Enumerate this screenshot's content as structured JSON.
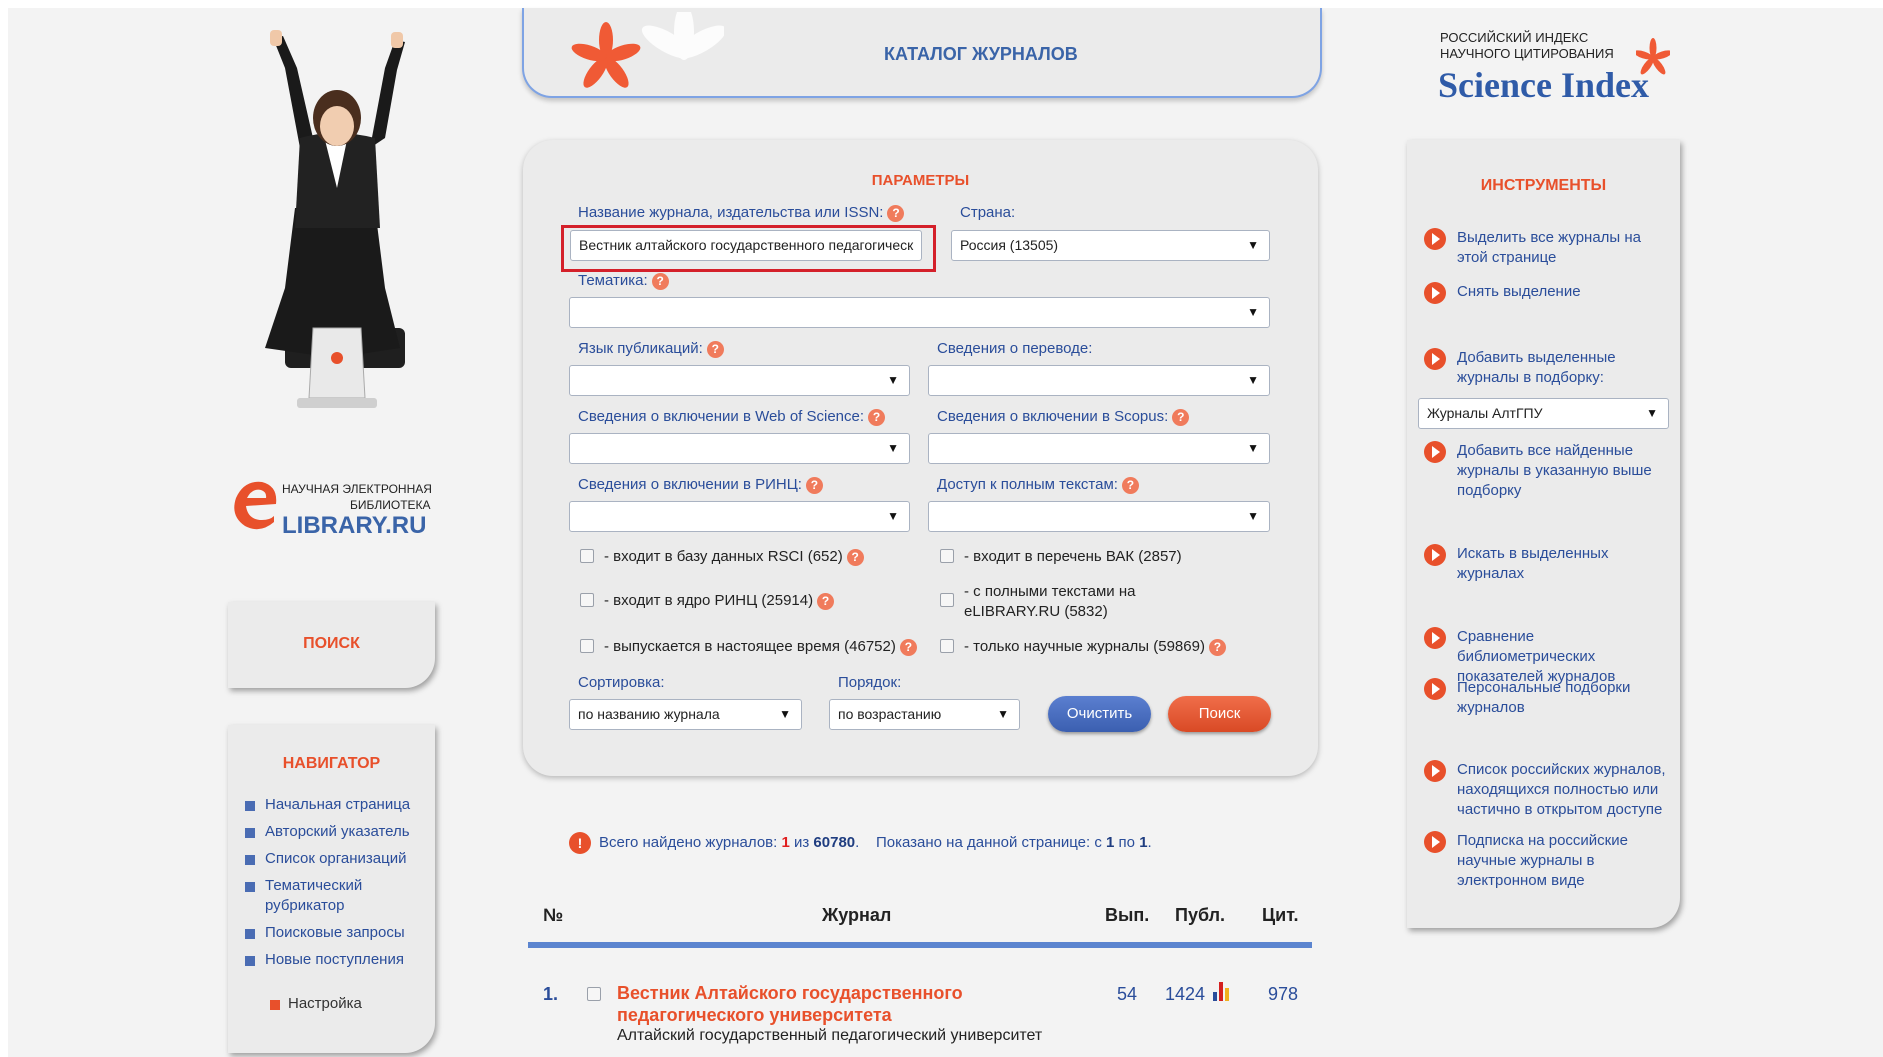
{
  "catalog": {
    "title": "КАТАЛОГ ЖУРНАЛОВ"
  },
  "brand": {
    "ri_line1": "РОССИЙСКИЙ ИНДЕКС",
    "ri_line2": "НАУЧНОГО ЦИТИРОВАНИЯ",
    "science_index": "Science Index",
    "elib_line1": "НАУЧНАЯ ЭЛЕКТРОННАЯ",
    "elib_line2": "БИБЛИОТЕКА",
    "elib_name": "LIBRARY.RU"
  },
  "left": {
    "search_label": "ПОИСК",
    "navigator_title": "НАВИГАТОР",
    "nav_items": [
      "Начальная страница",
      "Авторский указатель",
      "Список организаций",
      "Тематический рубрикатор",
      "Поисковые запросы",
      "Новые поступления"
    ],
    "settings": "Настройка"
  },
  "form": {
    "title": "ПАРАМЕТРЫ",
    "journal_label": "Название журнала, издательства или ISSN:",
    "journal_value": "Вестник алтайского государственного педагогическ",
    "country_label": "Страна:",
    "country_value": "Россия  (13505)",
    "topic_label": "Тематика:",
    "lang_label": "Язык публикаций:",
    "translation_label": "Сведения о переводе:",
    "wos_label": "Сведения о включении в Web of Science:",
    "scopus_label": "Сведения о включении в Scopus:",
    "rinc_label": "Сведения о включении в РИНЦ:",
    "fulltext_label": "Доступ к полным текстам:",
    "cb_rsci": "- входит в базу данных RSCI (652)",
    "cb_vak": "- входит в перечень ВАК (2857)",
    "cb_core": "- входит в ядро РИНЦ (25914)",
    "cb_fulltext": "- с полными текстами на eLIBRARY.RU (5832)",
    "cb_current": "- выпускается в настоящее время (46752)",
    "cb_scientific": "- только научные журналы (59869)",
    "sort_label": "Сортировка:",
    "sort_value": "по названию журнала",
    "order_label": "Порядок:",
    "order_value": "по возрастанию",
    "clear_button": "Очистить",
    "search_button": "Поиск"
  },
  "results": {
    "prefix": "Всего найдено журналов:",
    "found": "1",
    "of": "из",
    "total": "60780",
    "shown_prefix": "Показано на данной странице: с",
    "from": "1",
    "to_word": "по",
    "to": "1",
    "columns": {
      "num": "№",
      "journal": "Журнал",
      "issues": "Вып.",
      "pubs": "Публ.",
      "cit": "Цит."
    },
    "rows": [
      {
        "num": "1.",
        "title": "Вестник Алтайского государственного педагогического университета",
        "org": "Алтайский государственный педагогический университет",
        "issues": "54",
        "pubs": "1424",
        "cit": "978"
      }
    ]
  },
  "tools": {
    "title": "ИНСТРУМЕНТЫ",
    "select_all": "Выделить все журналы на этой странице",
    "deselect": "Снять выделение",
    "add_selected": "Добавить выделенные журналы в подборку:",
    "collection_value": "Журналы АлтГПУ",
    "add_all": "Добавить все найденные журналы в указанную выше подборку",
    "search_selected": "Искать в выделенных журналах",
    "compare": "Сравнение библиометрических показателей журналов",
    "personal": "Персональные подборки журналов",
    "open_access": "Список российских журналов, находящихся полностью или частично в открытом доступе",
    "subscription": "Подписка на российские научные журналы в электронном виде"
  },
  "colors": {
    "accent": "#e8502b",
    "link": "#2a4d9a",
    "highlight": "#d4202a"
  }
}
